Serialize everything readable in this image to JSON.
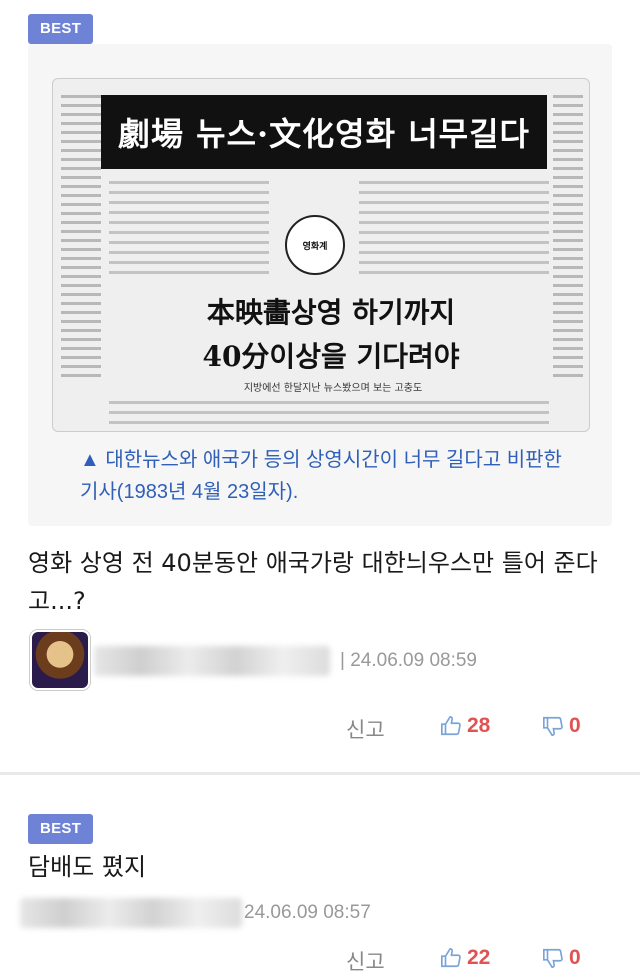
{
  "comments": [
    {
      "badge": "BEST",
      "image": {
        "headline": "劇場 뉴스·文化영화 너무길다",
        "subline1": "本映畵상영 하기까지",
        "subline2": "40分이상을 기다려야",
        "subline3": "지방에선 한달지난 뉴스봤으며 보는 고충도",
        "caption": "▲ 대한뉴스와 애국가 등의 상영시간이 너무 길다고 비판한 기사(1983년 4월 23일자)."
      },
      "text": "영화 상영 전 40분동안 애국가랑 대한늬우스만 틀어 준다고...?",
      "timestamp": "| 24.06.09 08:59",
      "report_label": "신고",
      "likes": "28",
      "dislikes": "0"
    },
    {
      "badge": "BEST",
      "text": "담배도 폈지",
      "timestamp": "24.06.09 08:57",
      "report_label": "신고",
      "likes": "22",
      "dislikes": "0"
    }
  ],
  "colors": {
    "badge": "#6e82d6",
    "caption": "#2f5fb8",
    "vote": "#e15353"
  }
}
